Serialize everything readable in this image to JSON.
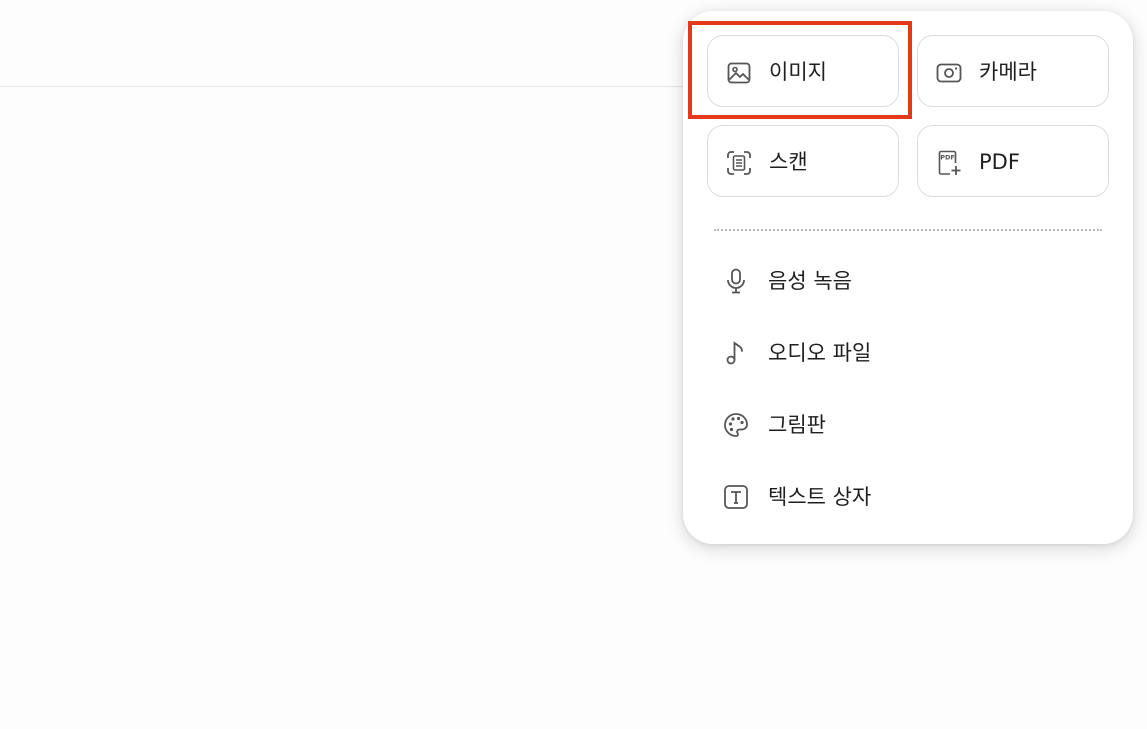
{
  "menu": {
    "tiles": [
      {
        "label": "이미지",
        "icon": "image-icon"
      },
      {
        "label": "카메라",
        "icon": "camera-icon"
      },
      {
        "label": "스캔",
        "icon": "scan-icon"
      },
      {
        "label": "PDF",
        "icon": "pdf-add-icon"
      }
    ],
    "items": [
      {
        "label": "음성 녹음",
        "icon": "microphone-icon"
      },
      {
        "label": "오디오 파일",
        "icon": "music-note-icon"
      },
      {
        "label": "그림판",
        "icon": "palette-icon"
      },
      {
        "label": "텍스트 상자",
        "icon": "text-box-icon"
      }
    ],
    "highlighted_tile": "이미지",
    "highlight_color": "#e2391b"
  },
  "pdf_icon_text": "PDF"
}
